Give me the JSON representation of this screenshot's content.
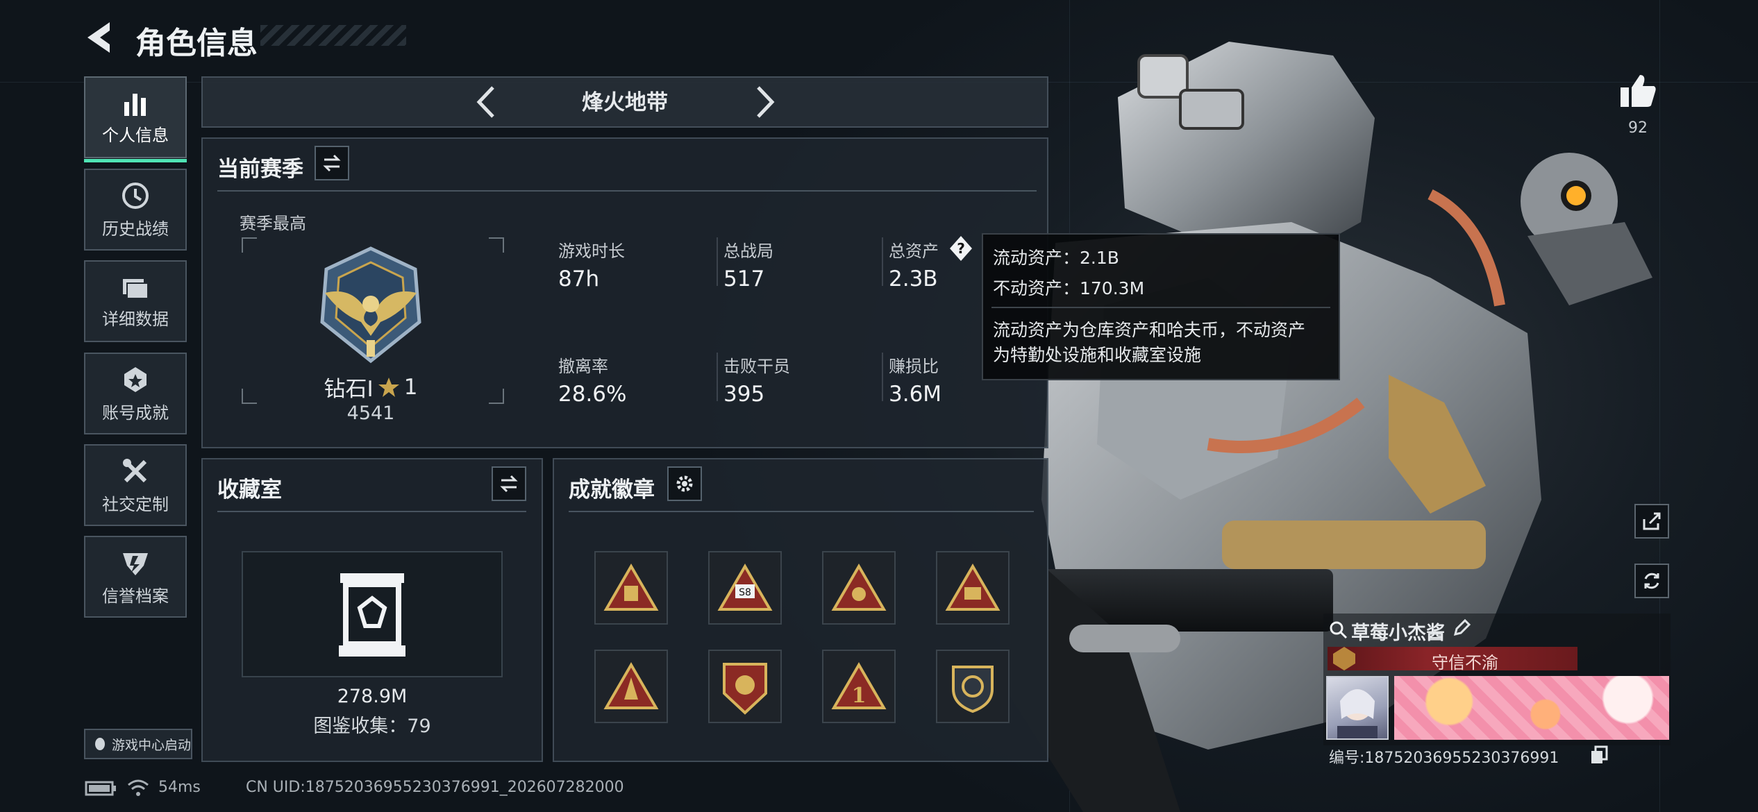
{
  "header": {
    "title": "角色信息"
  },
  "sidebar": {
    "items": [
      {
        "label": "个人信息",
        "icon": "bar-chart-icon",
        "active": true
      },
      {
        "label": "历史战绩",
        "icon": "clock-icon",
        "active": false
      },
      {
        "label": "详细数据",
        "icon": "folder-icon",
        "active": false
      },
      {
        "label": "账号成就",
        "icon": "medal-icon",
        "active": false
      },
      {
        "label": "社交定制",
        "icon": "tools-icon",
        "active": false
      },
      {
        "label": "信誉档案",
        "icon": "shield-icon",
        "active": false
      }
    ],
    "game_center_label": "游戏中心启动"
  },
  "mode_selector": {
    "label": "烽火地带"
  },
  "season": {
    "title": "当前赛季",
    "best_label": "赛季最高",
    "rank_name": "钻石I",
    "rank_stars": "1",
    "rank_score": "4541",
    "stats": [
      {
        "label": "游戏时长",
        "value": "87h"
      },
      {
        "label": "总战局",
        "value": "517"
      },
      {
        "label": "总资产",
        "value": "2.3B"
      },
      {
        "label": "撤离率",
        "value": "28.6%"
      },
      {
        "label": "击败干员",
        "value": "395"
      },
      {
        "label": "赚损比",
        "value": "3.6M"
      }
    ]
  },
  "tooltip": {
    "liquid": "流动资产：2.1B",
    "fixed": "不动资产：170.3M",
    "desc_line1": "流动资产为仓库资产和哈夫币，不动资产",
    "desc_line2": "为特勤处设施和收藏室设施"
  },
  "collection": {
    "title": "收藏室",
    "value": "278.9M",
    "catalog": "图鉴收集：79"
  },
  "achievements": {
    "title": "成就徽章",
    "badges": [
      "badge-1-icon",
      "badge-2-icon",
      "badge-3-icon",
      "badge-4-icon",
      "badge-5-icon",
      "badge-6-icon",
      "badge-7-icon",
      "badge-8-icon"
    ],
    "badge2_text": "S8",
    "badge7_text": "1"
  },
  "likes": {
    "count": "92"
  },
  "player": {
    "name": "草莓小杰酱",
    "title": "守信不渝",
    "id_line": "编号:18752036955230376991"
  },
  "status_bar": {
    "ping": "54ms",
    "uid": "CN UID:18752036955230376991_202607282000"
  },
  "colors": {
    "accent": "#4fe3b4",
    "title_red": "#7a1f22",
    "gold": "#c9a54e"
  }
}
